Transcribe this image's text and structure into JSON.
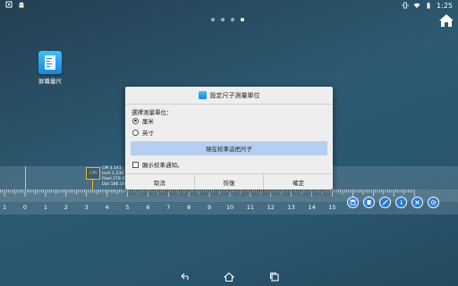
{
  "status_bar": {
    "time": "1:25",
    "left_icons": [
      "screenshot-icon",
      "android-icon"
    ],
    "right_icons": [
      "vibrate-icon",
      "wifi-icon",
      "battery-icon"
    ]
  },
  "home_pages": {
    "count": 4,
    "active_index": 3
  },
  "desktop_app": {
    "label": "屏幕量尺",
    "icon": "ruler-app-icon"
  },
  "ruler": {
    "tick_labels": [
      "1",
      "0",
      "1",
      "2",
      "3",
      "4",
      "5",
      "6",
      "7",
      "8",
      "9",
      "10",
      "11",
      "12",
      "13",
      "14",
      "15"
    ],
    "cm_marker": "CM",
    "readout": {
      "cm": "CM 3.141",
      "inch": "Inch 1.236",
      "pixel": "Pixel 279.25",
      "dot": "Dot 186.16"
    },
    "tools": [
      "save-icon",
      "copy-icon",
      "brush-icon",
      "info-icon",
      "close-icon",
      "settings-icon"
    ]
  },
  "dialog": {
    "title": "設定尺子測量單位",
    "prompt": "選擇測量單位：",
    "options": [
      {
        "label": "厘米",
        "selected": true
      },
      {
        "label": "英寸",
        "selected": false
      }
    ],
    "calibrate_button": "現在校準這把尺子",
    "notify_checkbox": {
      "label": "顯示校準通知。",
      "checked": false
    },
    "buttons": {
      "cancel": "取消",
      "restore": "恢復",
      "ok": "確定"
    }
  },
  "nav_bar": {
    "buttons": [
      "back-icon",
      "home-icon",
      "recents-icon"
    ]
  },
  "colors": {
    "accent_blue": "#2a7bd1",
    "calibrate_button": "#b5cff0",
    "marker_yellow": "#f0b429"
  }
}
